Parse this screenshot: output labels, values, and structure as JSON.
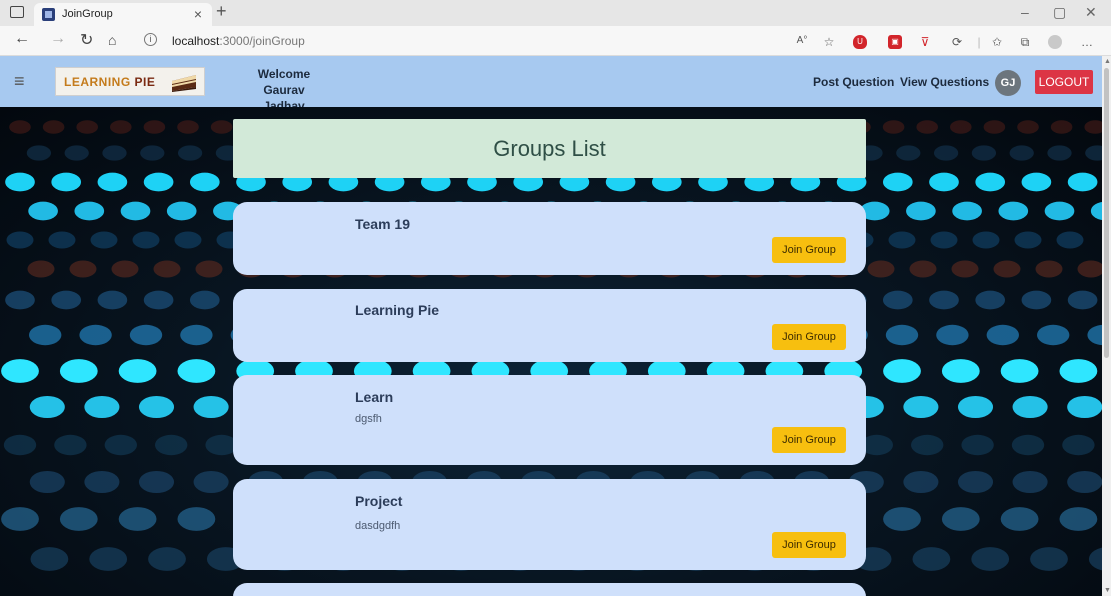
{
  "browser": {
    "tab_title": "JoinGroup",
    "url_host": "localhost",
    "url_path": ":3000/joinGroup"
  },
  "navbar": {
    "logo_word1": "LEARNING",
    "logo_word2": "PIE",
    "welcome_line1": "Welcome",
    "welcome_line2": "Gaurav Jadhav",
    "post_question": "Post Question",
    "view_questions": "View Questions",
    "avatar_initials": "GJ",
    "logout": "LOGOUT"
  },
  "page": {
    "title": "Groups List"
  },
  "groups": [
    {
      "name": "Team 19",
      "description": "",
      "button": "Join Group"
    },
    {
      "name": "Learning Pie",
      "description": "",
      "button": "Join Group"
    },
    {
      "name": "Learn",
      "description": "dgsfh",
      "button": "Join Group"
    },
    {
      "name": "Project",
      "description": "dasdgdfh",
      "button": "Join Group"
    }
  ],
  "colors": {
    "navbar": "#a7c9f0",
    "card": "#cfe0fb",
    "header": "#d2e9d8",
    "join_button": "#f7bf0f",
    "logout_button": "#dc3545"
  },
  "icons": {
    "menu": "hamburger-icon",
    "back": "back-arrow-icon",
    "refresh": "refresh-icon",
    "home": "home-icon"
  }
}
